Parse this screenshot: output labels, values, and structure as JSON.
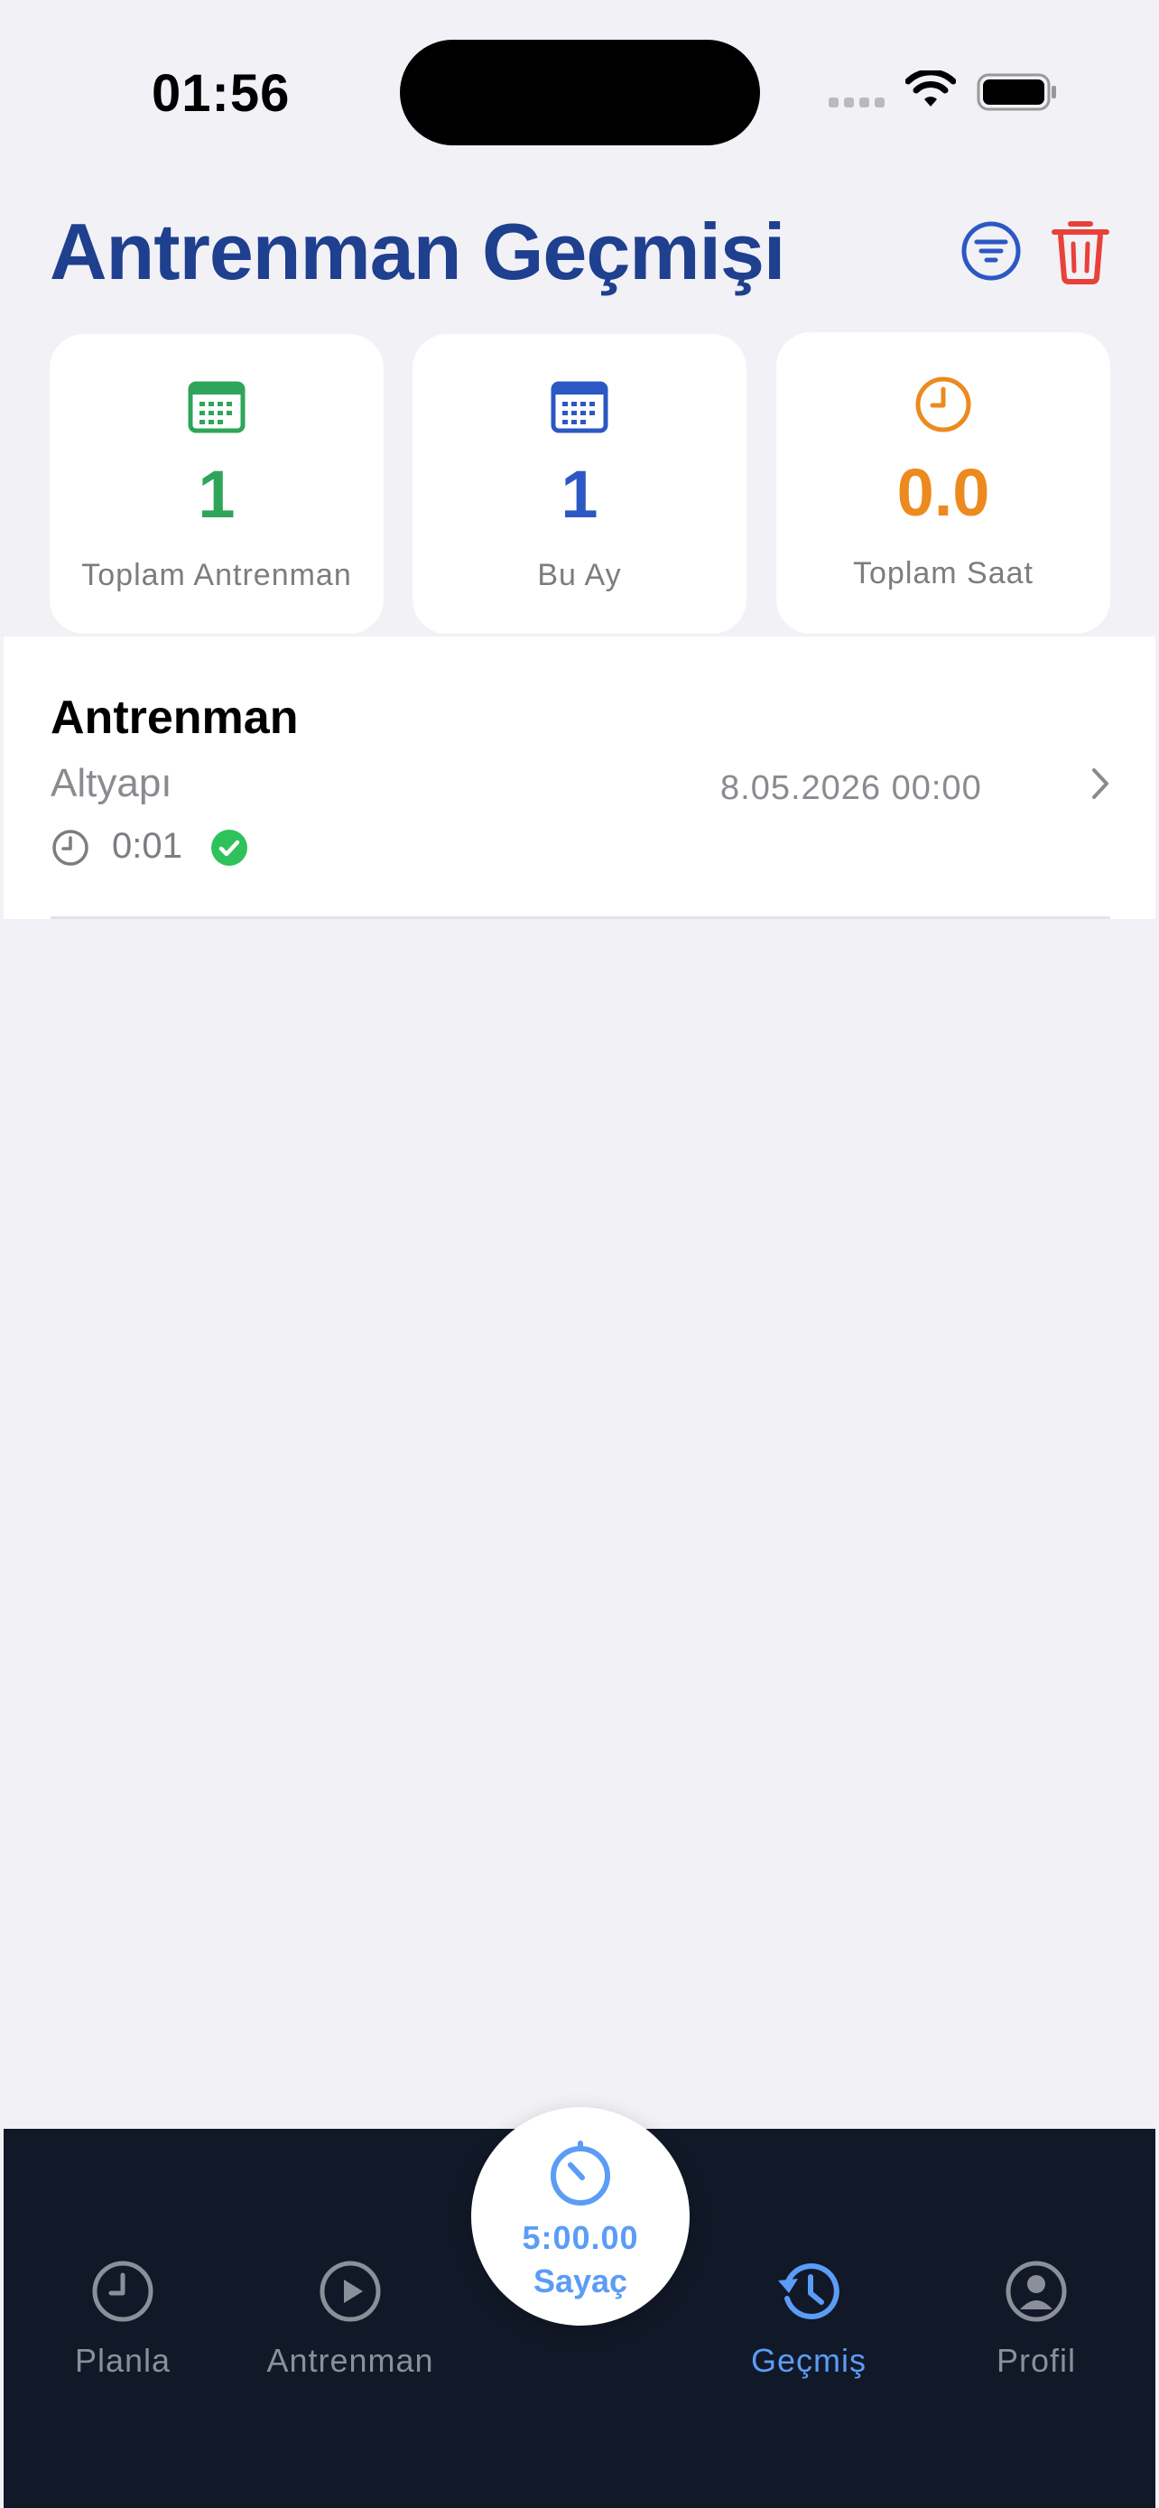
{
  "status_bar": {
    "time": "01:56"
  },
  "header": {
    "title": "Antrenman Geçmişi",
    "filter_icon": "filter-icon",
    "trash_icon": "trash-icon"
  },
  "stats": [
    {
      "icon": "calendar-icon",
      "value": "1",
      "label": "Toplam Antrenman",
      "color": "#2fa55a"
    },
    {
      "icon": "calendar-icon",
      "value": "1",
      "label": "Bu Ay",
      "color": "#2c58c4"
    },
    {
      "icon": "clock-icon",
      "value": "0.0",
      "label": "Toplam Saat",
      "color": "#ec8a1f"
    }
  ],
  "history": [
    {
      "title": "Antrenman",
      "subtitle": "Altyapı",
      "date": "8.05.2026 00:00",
      "duration": "0:01",
      "completed": true
    }
  ],
  "timer": {
    "value": "5:00.00",
    "label": "Sayaç"
  },
  "tabs": [
    {
      "label": "Planla",
      "icon": "clock-icon",
      "active": false
    },
    {
      "label": "Antrenman",
      "icon": "play-icon",
      "active": false
    },
    {
      "label": "Geçmiş",
      "icon": "history-icon",
      "active": true
    },
    {
      "label": "Profil",
      "icon": "profile-icon",
      "active": false
    }
  ],
  "colors": {
    "title": "#1f3f8f",
    "accent_blue": "#5b9cf6",
    "danger": "#e8413a",
    "success": "#2fc25a",
    "tabbar_bg": "#111827",
    "page_bg": "#f1f1f6"
  }
}
